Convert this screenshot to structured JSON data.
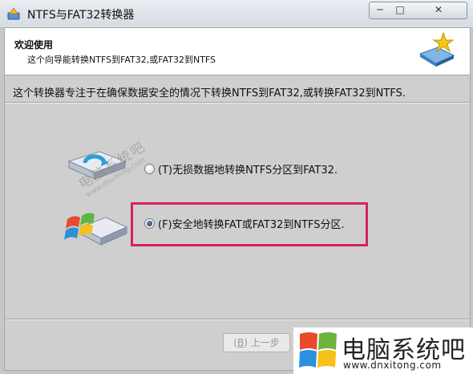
{
  "window": {
    "title": "NTFS与FAT32转换器",
    "min_label": "─",
    "max_label": "□",
    "close_label": "✕"
  },
  "header": {
    "title": "欢迎使用",
    "subtitle": "这个向导能转换NTFS到FAT32,或FAT32到NTFS",
    "icon": "wizard-star-icon"
  },
  "description": "这个转换器专注于在确保数据安全的情况下转换NTFS到FAT32,或转换FAT32到NTFS.",
  "options": [
    {
      "label": "(T)无损数据地转换NTFS分区到FAT32.",
      "selected": false,
      "icon": "drive-convert-icon"
    },
    {
      "label": "(F)安全地转换FAT或FAT32到NTFS分区.",
      "selected": true,
      "icon": "drive-windows-icon"
    }
  ],
  "watermark": {
    "text": "电脑系统吧",
    "url": "www.dnxitong.com"
  },
  "buttons": {
    "prev_mnemonic": "B",
    "prev_label": "上一步"
  },
  "brand": {
    "name": "电脑系统吧",
    "url": "www.dnxitong.com",
    "logo": "windows-logo-icon"
  },
  "colors": {
    "highlight": "#d4235b",
    "titlebar": "#dfe4ea",
    "client_bg": "#cfcfcf"
  }
}
